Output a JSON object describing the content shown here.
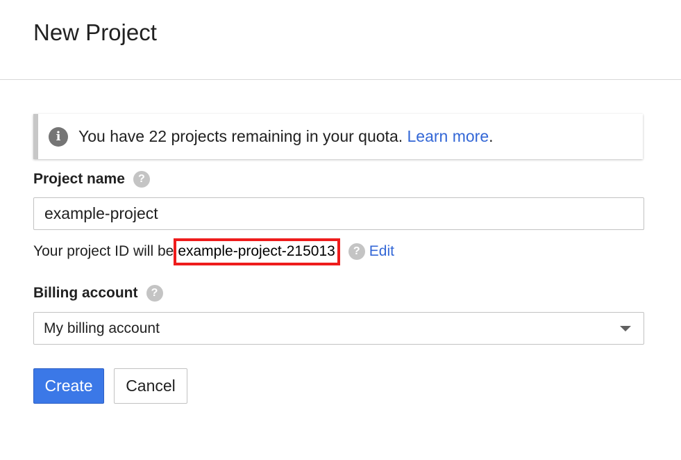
{
  "page": {
    "title": "New Project"
  },
  "notice": {
    "text": "You have 22 projects remaining in your quota. ",
    "link": "Learn more",
    "trailing": "."
  },
  "project_name": {
    "label": "Project name",
    "value": "example-project"
  },
  "project_id": {
    "prefix": "Your project ID will be",
    "value": "example-project-215013",
    "edit_label": "Edit"
  },
  "billing": {
    "label": "Billing account",
    "selected": "My billing account"
  },
  "actions": {
    "create_label": "Create",
    "cancel_label": "Cancel"
  },
  "icons": {
    "info": "info-icon",
    "help": "help-icon",
    "dropdown": "caret-down-icon"
  },
  "colors": {
    "primary": "#3b78e7",
    "link": "#3367d6",
    "highlight_border": "#ee1c1c"
  }
}
